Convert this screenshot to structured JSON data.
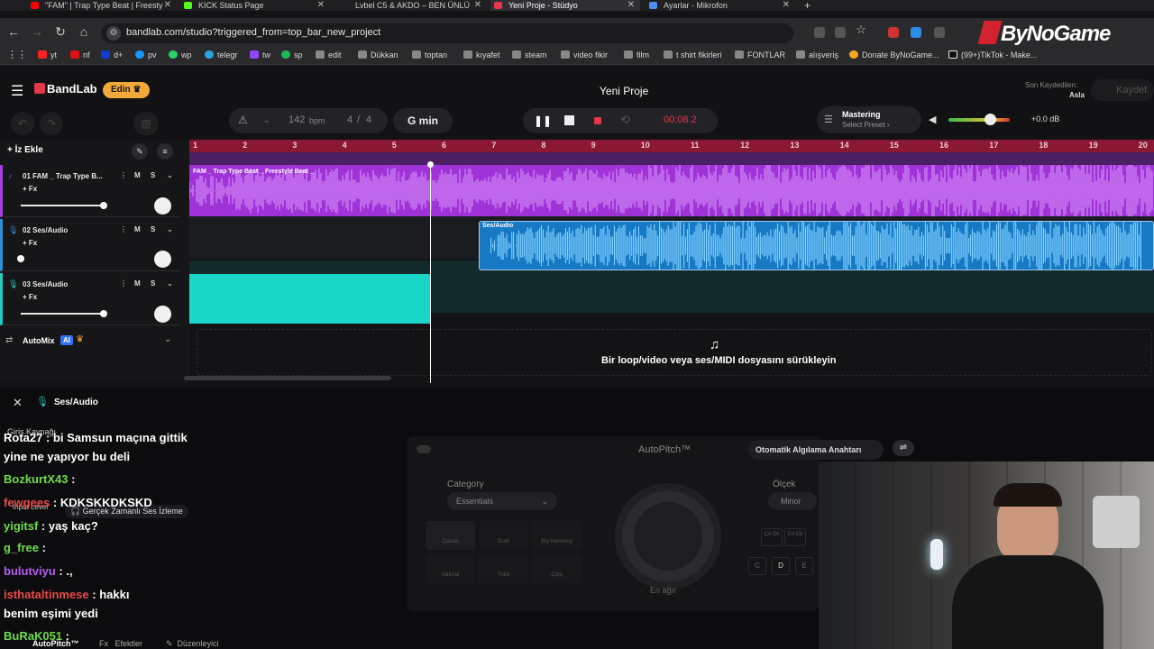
{
  "tabs": [
    {
      "label": "\"FAM\" | Trap Type Beat | Freesty",
      "color": "#ff0000"
    },
    {
      "label": "KICK Status Page",
      "color": "#53fc18"
    },
    {
      "label": "Lvbel C5 & AKDO – BEN ÜNLÜ",
      "color": "#777777"
    },
    {
      "label": "Yeni Proje - Stüdyo",
      "color": "#e3374b"
    },
    {
      "label": "Ayarlar - Mikrofon",
      "color": "#4a8ef5"
    }
  ],
  "address": {
    "url": "bandlab.com/studio?triggered_from=top_bar_new_project"
  },
  "bookmarks": [
    "yt",
    "nf",
    "d+",
    "pv",
    "wp",
    "telegr",
    "tw",
    "sp",
    "edit",
    "Dükkan",
    "toptan",
    "kıyafet",
    "steam",
    "video fikir",
    "film",
    "t shirt fikirleri",
    "FONTLAR",
    "alışveriş",
    "Donate ByNoGame...",
    "(99+)TikTok - Make..."
  ],
  "overlay_logo": "ByNoGame",
  "header": {
    "brand": "BandLab",
    "upgrade": "Edin",
    "project_title": "Yeni Proje",
    "last_saved_label": "Son Kaydedilen:",
    "last_saved_value": "Asla",
    "save": "Kaydet"
  },
  "controls": {
    "bpm": "142",
    "bpm_unit": "bpm",
    "time_sig_num": "4",
    "time_sig_sep": "/",
    "time_sig_den": "4",
    "key": "G min",
    "time": "00:08.2",
    "mastering_title": "Mastering",
    "mastering_preset": "Select Preset",
    "volume_db": "+0.0 dB",
    "add_track": "İz Ekle"
  },
  "ruler": [
    "1",
    "2",
    "3",
    "4",
    "5",
    "6",
    "7",
    "8",
    "9",
    "10",
    "11",
    "12",
    "13",
    "14",
    "15",
    "16",
    "17",
    "18",
    "19",
    "20"
  ],
  "tracks": [
    {
      "name": "01  FAM _ Trap Type B...",
      "fx": "+ Fx",
      "m": "M",
      "s": "S",
      "color": "#a23fe0",
      "vol": 0.55
    },
    {
      "name": "02  Ses/Audio",
      "fx": "+ Fx",
      "m": "M",
      "s": "S",
      "color": "#2e8fd8",
      "vol": 0.0
    },
    {
      "name": "03  Ses/Audio",
      "fx": "+ Fx",
      "m": "M",
      "s": "S",
      "color": "#20cbc0",
      "vol": 0.55
    }
  ],
  "clips": [
    {
      "label": "FAM _ Trap Type Beat _ Freestyle Beat _"
    },
    {
      "label": "Ses/Audio"
    }
  ],
  "automix": {
    "label": "AutoMix",
    "badge": "AI"
  },
  "dropzone": "Bir loop/video veya ses/MIDI dosyasını sürükleyin",
  "panel": {
    "title": "Ses/Audio",
    "input_source": "Giriş Kaynağı",
    "input_level": "Input Level",
    "monitoring": "Gerçek Zamanlı Ses İzleme",
    "autopitch": "AutoPitch™",
    "auto_detect": "Otomatik Algılama Anahtarı",
    "category_label": "Category",
    "category_value": "Essentials",
    "scale_label": "Ölçek",
    "scale_value": "Minor",
    "presets": [
      "Classic",
      "Duet",
      "Big Harmony",
      "Natural",
      "Third",
      "Chip"
    ],
    "knob_label": "En ağır",
    "key_buttons": [
      "C",
      "D",
      "E"
    ],
    "key_sharps": [
      "Ç# Db",
      "D# Eb"
    ],
    "tabs": [
      "AutoPitch™",
      "Efektler",
      "Düzenleyici"
    ],
    "tab_fx_prefix": "Fx"
  },
  "chat": [
    {
      "user": "Rota27",
      "msg": ": bi Samsun maçına gittik",
      "color": "#ffffff"
    },
    {
      "user": "",
      "msg": "yine ne yapıyor bu deli",
      "color": "#ffffff"
    },
    {
      "user": "BozkurtX43",
      "msg": ":",
      "color": "#6ddc4b"
    },
    {
      "user": "fewgees",
      "msg": ": KDKSKKDKSKD",
      "color": "#e84a4a"
    },
    {
      "user": "yigitsf",
      "msg": ": yaş kaç?",
      "color": "#6ddc4b"
    },
    {
      "user": "g_free",
      "msg": ":",
      "color": "#6ddc4b"
    },
    {
      "user": "bulutviyu",
      "msg": ": .,",
      "color": "#b75cf0"
    },
    {
      "user": "isthataltinmese",
      "msg": ": hakkı",
      "color": "#e84a4a"
    },
    {
      "user": "",
      "msg": "benim eşimi yedi",
      "color": "#ffffff"
    },
    {
      "user": "BuRaK051",
      "msg": ":",
      "color": "#6ddc4b"
    }
  ]
}
